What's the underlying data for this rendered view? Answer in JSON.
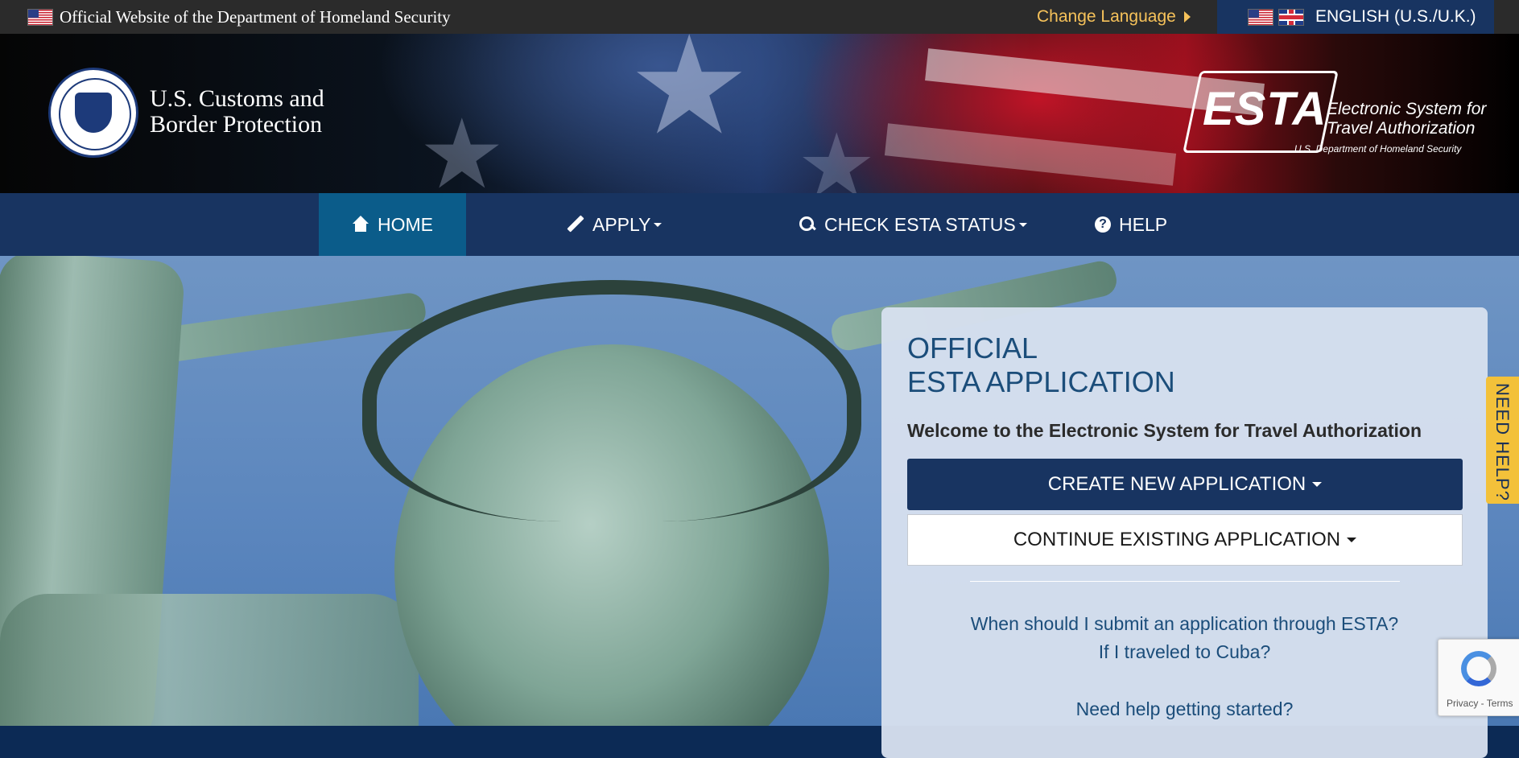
{
  "topbar": {
    "official_text": "Official Website of the Department of Homeland Security",
    "change_language": "Change Language",
    "language": "ENGLISH (U.S./U.K.)"
  },
  "header": {
    "agency_line1": "U.S. Customs and",
    "agency_line2": "Border Protection",
    "esta_word": "ESTA",
    "esta_sub_line1": "Electronic System for",
    "esta_sub_line2": "Travel Authorization",
    "esta_dept": "U.S. Department of Homeland Security"
  },
  "nav": {
    "items": [
      {
        "label": "HOME",
        "icon": "home-icon",
        "active": true
      },
      {
        "label": "APPLY",
        "icon": "pencil-icon",
        "dropdown": true
      },
      {
        "label": "CHECK ESTA STATUS",
        "icon": "search-icon",
        "dropdown": true
      },
      {
        "label": "HELP",
        "icon": "question-circle-icon"
      }
    ]
  },
  "card": {
    "title_line1": "OFFICIAL",
    "title_line2": "ESTA APPLICATION",
    "welcome": "Welcome to the Electronic System for Travel Authorization",
    "create_button": "CREATE NEW APPLICATION",
    "continue_button": "CONTINUE EXISTING APPLICATION",
    "faq": [
      "When should I submit an application through ESTA?",
      "If I traveled to Cuba?",
      "Need help getting started?"
    ]
  },
  "need_help_tab": "NEED HELP?",
  "recaptcha": {
    "links": "Privacy - Terms"
  },
  "colors": {
    "nav_bg": "#183461",
    "nav_active": "#0b5c8a",
    "accent_yellow": "#f3c13a",
    "title_blue": "#1b4d7a"
  }
}
